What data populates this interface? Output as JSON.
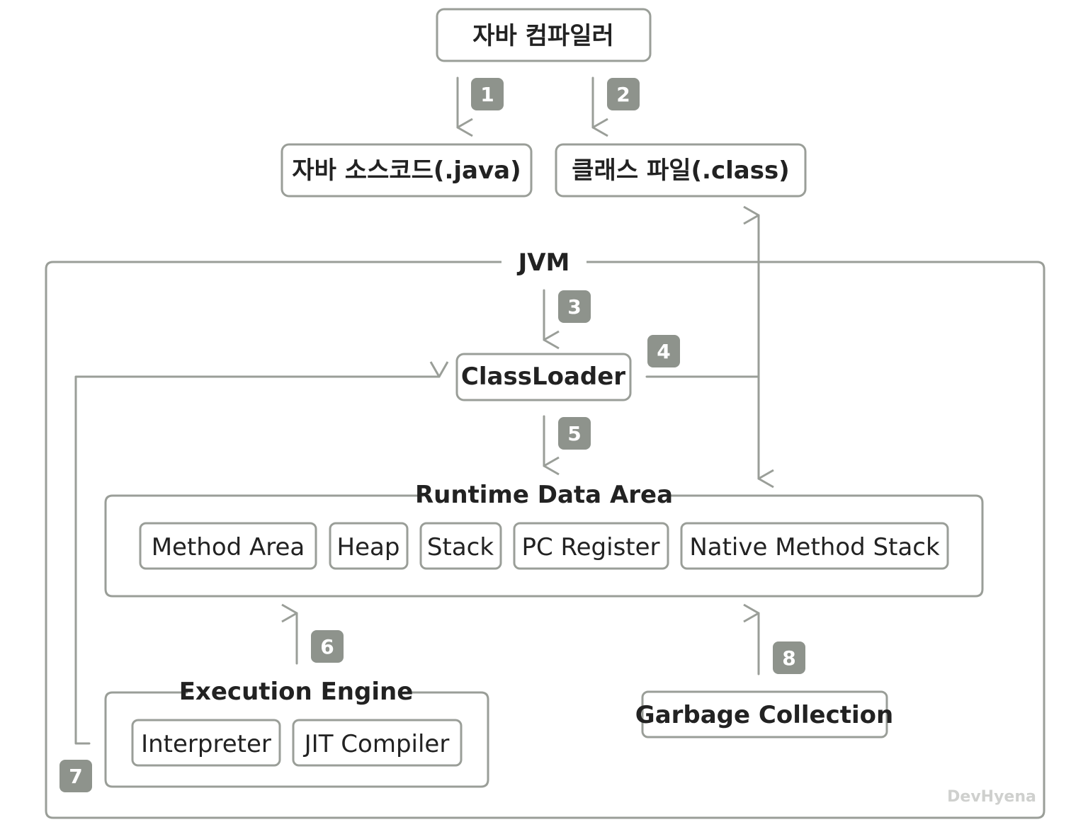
{
  "nodes": {
    "compiler": "자바 컴파일러",
    "java_source": "자바 소스코드(.java)",
    "class_file": "클래스 파일(.class)",
    "jvm": "JVM",
    "class_loader": "ClassLoader",
    "runtime_data_area": "Runtime Data Area",
    "runtime_items": [
      "Method Area",
      "Heap",
      "Stack",
      "PC Register",
      "Native Method Stack"
    ],
    "execution_engine": "Execution Engine",
    "engine_items": [
      "Interpreter",
      "JIT Compiler"
    ],
    "garbage_collection": "Garbage Collection"
  },
  "steps": [
    "1",
    "2",
    "3",
    "4",
    "5",
    "6",
    "7",
    "8"
  ],
  "watermark": "DevHyena",
  "colors": {
    "stroke": "#9a9e98",
    "badge": "#8e938c",
    "text": "#222222"
  }
}
